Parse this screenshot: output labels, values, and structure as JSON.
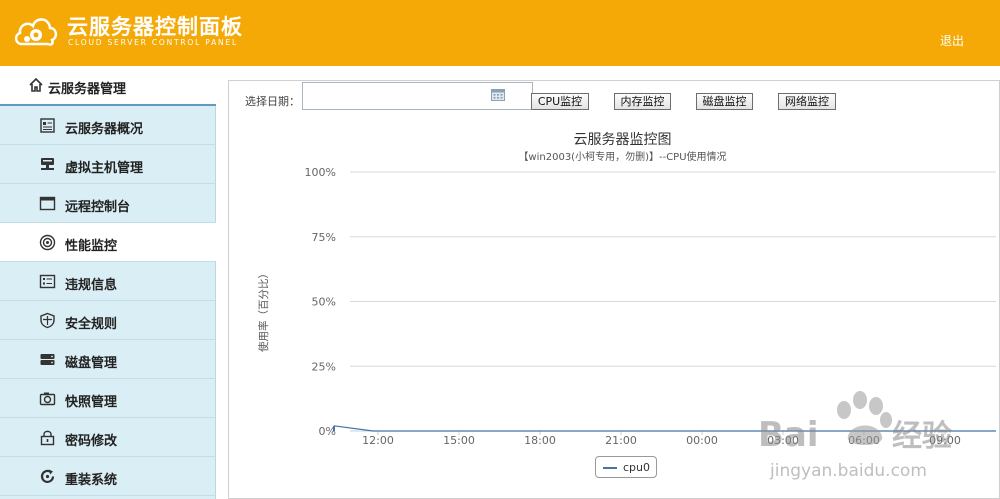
{
  "header": {
    "title": "云服务器控制面板",
    "subtitle": "CLOUD SERVER CONTROL PANEL",
    "logout": "退出",
    "brand_color": "#f5a906"
  },
  "sidebar": {
    "heading": "云服务器管理",
    "items": [
      {
        "label": "云服务器概况",
        "icon": "document-icon"
      },
      {
        "label": "虚拟主机管理",
        "icon": "server-icon"
      },
      {
        "label": "远程控制台",
        "icon": "window-icon"
      },
      {
        "label": "性能监控",
        "icon": "target-icon",
        "active": true
      },
      {
        "label": "违规信息",
        "icon": "list-icon"
      },
      {
        "label": "安全规则",
        "icon": "shield-icon"
      },
      {
        "label": "磁盘管理",
        "icon": "disk-icon"
      },
      {
        "label": "快照管理",
        "icon": "camera-icon"
      },
      {
        "label": "密码修改",
        "icon": "lock-icon"
      },
      {
        "label": "重装系统",
        "icon": "reload-icon"
      }
    ]
  },
  "toolbar": {
    "date_label": "选择日期：",
    "date_value": "",
    "buttons": [
      "CPU监控",
      "内存监控",
      "磁盘监控",
      "网络监控"
    ]
  },
  "chart_data": {
    "type": "line",
    "title": "云服务器监控图",
    "subtitle": "【win2003(小柯专用，勿删)】--CPU使用情况",
    "ylabel": "使用率（百分比）",
    "xlabel": "",
    "x_ticks": [
      "12:00",
      "15:00",
      "18:00",
      "21:00",
      "00:00",
      "03:00",
      "06:00",
      "09:00"
    ],
    "y_ticks": [
      "0%",
      "25%",
      "50%",
      "75%",
      "100%"
    ],
    "ylim": [
      0,
      100
    ],
    "grid": true,
    "legend_position": "bottom-center",
    "series": [
      {
        "name": "cpu0",
        "color": "#4572a7",
        "values": [
          2,
          0,
          0,
          0,
          0,
          0,
          0,
          0,
          0,
          0,
          0,
          0,
          0,
          0,
          0,
          0,
          0,
          0
        ]
      }
    ]
  },
  "watermark": {
    "text": "Baidu经验",
    "url": "jingyan.baidu.com"
  }
}
